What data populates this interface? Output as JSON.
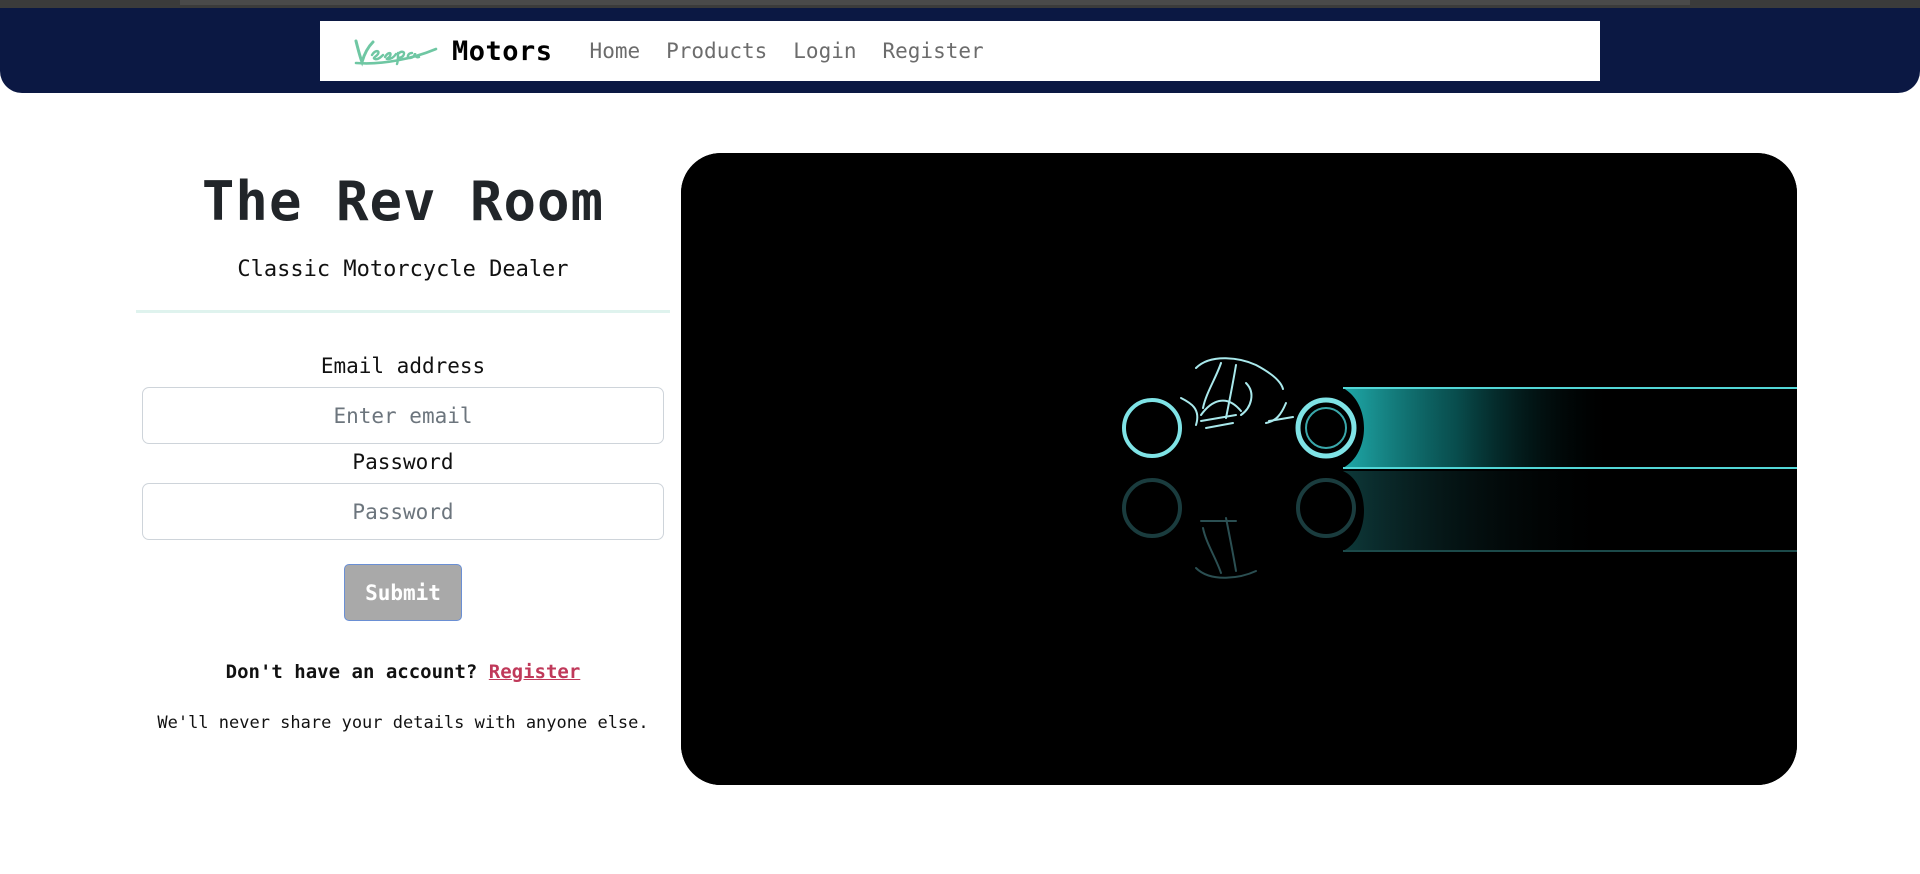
{
  "brand": {
    "logo_text": "Vespa",
    "name": "Motors",
    "logo_color": "#6fc7a3"
  },
  "nav": {
    "items": [
      {
        "label": "Home"
      },
      {
        "label": "Products"
      },
      {
        "label": "Login"
      },
      {
        "label": "Register"
      }
    ]
  },
  "hero_left": {
    "title": "The Rev Room",
    "subtitle": "Classic Motorcycle Dealer"
  },
  "login_form": {
    "email_label": "Email address",
    "email_placeholder": "Enter email",
    "email_value": "",
    "password_label": "Password",
    "password_placeholder": "Password",
    "password_value": "",
    "submit_label": "Submit",
    "signup_prompt": "Don't have an account?",
    "signup_link": "Register",
    "disclaimer": "We'll never share your details with anyone else."
  },
  "hero_image": {
    "subject": "neon light-cycle motorcycle",
    "accent_color": "#52d6d6",
    "background": "#000000"
  },
  "theme": {
    "header_band": "#0b1843",
    "link_accent": "#c0395a",
    "button_bg": "#a9a9a9"
  }
}
